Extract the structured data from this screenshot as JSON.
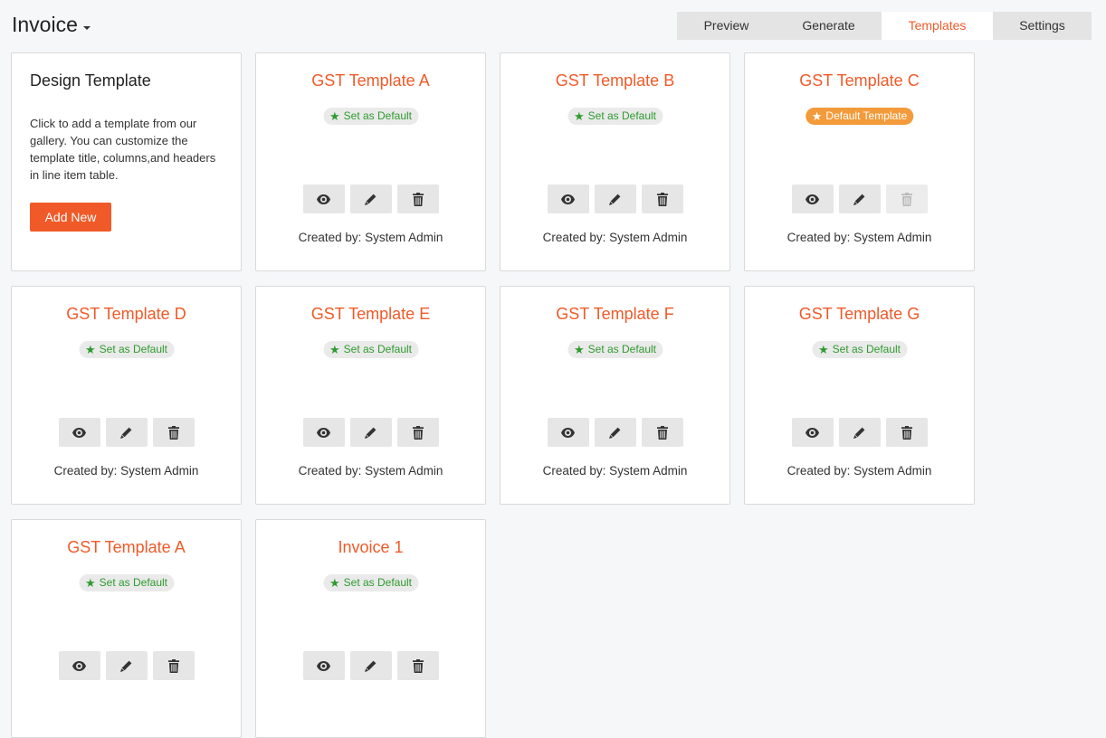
{
  "header": {
    "title": "Invoice"
  },
  "tabs": [
    {
      "label": "Preview",
      "active": false
    },
    {
      "label": "Generate",
      "active": false
    },
    {
      "label": "Templates",
      "active": true
    },
    {
      "label": "Settings",
      "active": false
    }
  ],
  "design_card": {
    "title": "Design Template",
    "description": "Click to add a template from our gallery. You can customize the template title, columns,and headers in line item table.",
    "button_label": "Add New"
  },
  "templates": [
    {
      "name": "GST Template A",
      "badge": "Set as Default",
      "is_default": false,
      "created_by": "Created by: System Admin"
    },
    {
      "name": "GST Template B",
      "badge": "Set as Default",
      "is_default": false,
      "created_by": "Created by: System Admin"
    },
    {
      "name": "GST Template C",
      "badge": "Default Template",
      "is_default": true,
      "created_by": "Created by: System Admin"
    },
    {
      "name": "GST Template D",
      "badge": "Set as Default",
      "is_default": false,
      "created_by": "Created by: System Admin"
    },
    {
      "name": "GST Template E",
      "badge": "Set as Default",
      "is_default": false,
      "created_by": "Created by: System Admin"
    },
    {
      "name": "GST Template F",
      "badge": "Set as Default",
      "is_default": false,
      "created_by": "Created by: System Admin"
    },
    {
      "name": "GST Template G",
      "badge": "Set as Default",
      "is_default": false,
      "created_by": "Created by: System Admin"
    },
    {
      "name": "GST Template A",
      "badge": "Set as Default",
      "is_default": false,
      "created_by": ""
    },
    {
      "name": "Invoice 1",
      "badge": "Set as Default",
      "is_default": false,
      "created_by": ""
    }
  ],
  "colors": {
    "accent": "#f05a28",
    "success": "#2e9b2e",
    "default_badge": "#f39a3a"
  },
  "icons": {
    "view": "eye-icon",
    "edit": "pencil-icon",
    "delete": "trash-icon",
    "star": "star-icon",
    "caret": "caret-down-icon"
  }
}
